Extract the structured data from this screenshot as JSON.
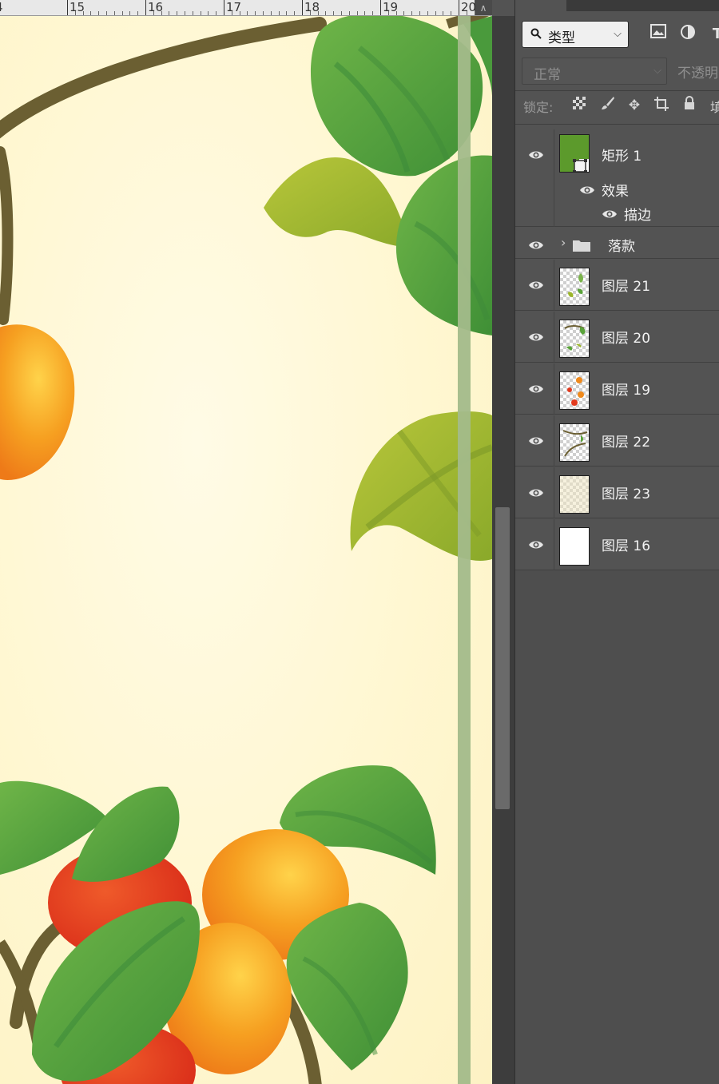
{
  "ruler": {
    "labels": [
      "15",
      "16",
      "17",
      "18",
      "19",
      "20"
    ],
    "scroll_up_glyph": "∧"
  },
  "layers_panel": {
    "filter": {
      "kind_label": "类型",
      "icons": [
        "image-filter-icon",
        "adjustment-filter-icon",
        "type-filter-icon"
      ],
      "type_glyph": "T"
    },
    "blend_mode": "正常",
    "opacity_label": "不透明",
    "lock": {
      "label": "锁定:",
      "icons": [
        "lock-transparent-icon",
        "lock-paint-icon",
        "lock-move-icon",
        "lock-artboard-icon",
        "lock-all-icon"
      ],
      "fill_label": "填"
    },
    "shape_layer": {
      "name": "矩形 1",
      "effects_label": "效果",
      "stroke_label": "描边",
      "thumb_color": "#5c9a2c"
    },
    "group": {
      "name": "落款"
    },
    "layers": [
      {
        "name": "图层 21",
        "thumb": "leaves"
      },
      {
        "name": "图层 20",
        "thumb": "leaves"
      },
      {
        "name": "图层 19",
        "thumb": "fruit"
      },
      {
        "name": "图层 22",
        "thumb": "branches"
      },
      {
        "name": "图层 23",
        "thumb": "beige"
      },
      {
        "name": "图层 16",
        "thumb": "white"
      }
    ]
  },
  "colors": {
    "panel_bg": "#535353",
    "canvas_bg": "#fff7d1",
    "leaf_green": "#5aa33a",
    "leaf_yellow_green": "#9bb52a",
    "branch": "#6b5f32",
    "fruit_orange": "#f08a1c",
    "fruit_red": "#e23a1e",
    "stroke_line": "#a3bb8a"
  }
}
